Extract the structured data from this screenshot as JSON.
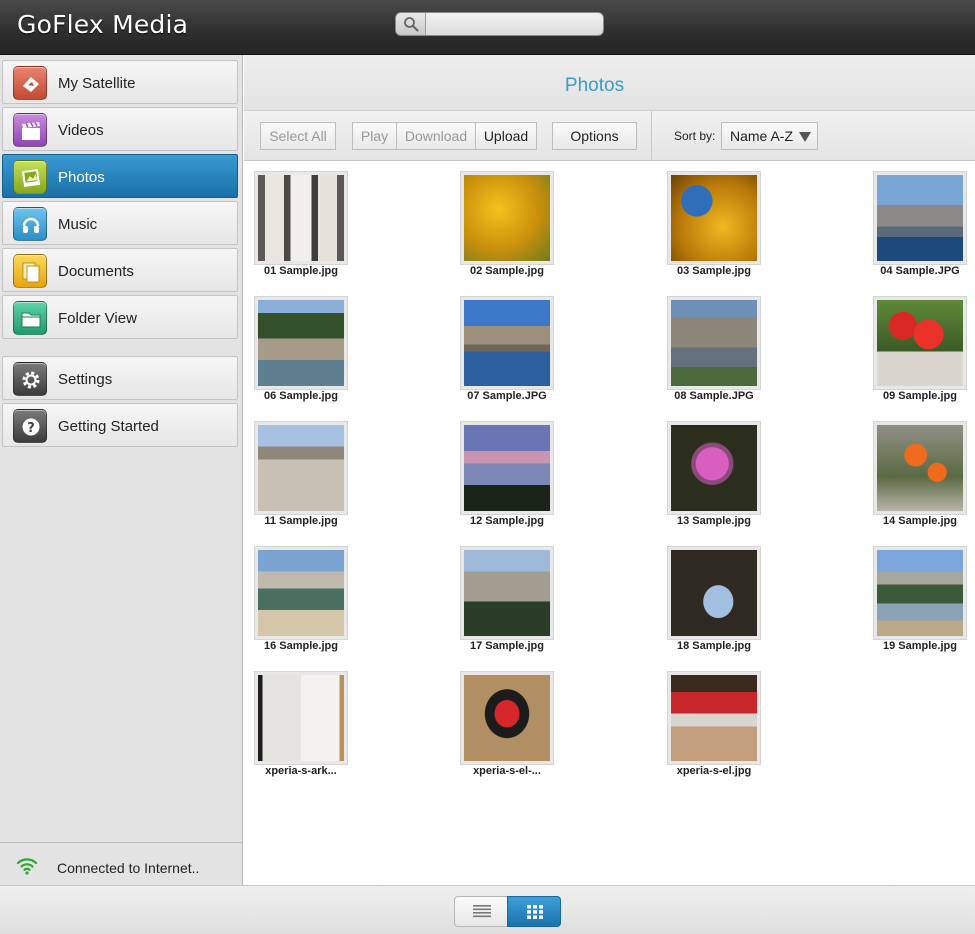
{
  "app": {
    "title": "GoFlex Media"
  },
  "search": {
    "placeholder": "",
    "value": ""
  },
  "sidebar": {
    "items": [
      {
        "label": "My Satellite",
        "icon": "satellite-icon"
      },
      {
        "label": "Videos",
        "icon": "clapperboard-icon"
      },
      {
        "label": "Photos",
        "icon": "photos-icon",
        "active": true
      },
      {
        "label": "Music",
        "icon": "music-icon"
      },
      {
        "label": "Documents",
        "icon": "documents-icon"
      },
      {
        "label": "Folder View",
        "icon": "folder-icon"
      },
      {
        "label": "Settings",
        "icon": "gear-icon"
      },
      {
        "label": "Getting Started",
        "icon": "question-icon"
      }
    ],
    "status": "Connected to Internet.."
  },
  "header": {
    "title": "Photos"
  },
  "toolbar": {
    "select_all": "Select All",
    "play": "Play",
    "download": "Download",
    "upload": "Upload",
    "options": "Options",
    "sort_label": "Sort by:",
    "sort_value": "Name A-Z"
  },
  "photos": [
    "01 Sample.jpg",
    "02 Sample.jpg",
    "03 Sample.jpg",
    "04 Sample.JPG",
    "06 Sample.jpg",
    "07 Sample.JPG",
    "08 Sample.JPG",
    "09 Sample.jpg",
    "11 Sample.jpg",
    "12 Sample.jpg",
    "13 Sample.jpg",
    "14 Sample.jpg",
    "16 Sample.jpg",
    "17 Sample.jpg",
    "18 Sample.jpg",
    "19 Sample.jpg",
    "xperia-s-ark...",
    "xperia-s-el-...",
    "xperia-s-el.jpg"
  ],
  "colors": {
    "accent": "#1f78b4",
    "title_accent": "#3a9cc8",
    "topbar": "#2e2e2e"
  },
  "view_modes": [
    "list-view-icon",
    "grid-view-icon"
  ],
  "active_view": "grid"
}
